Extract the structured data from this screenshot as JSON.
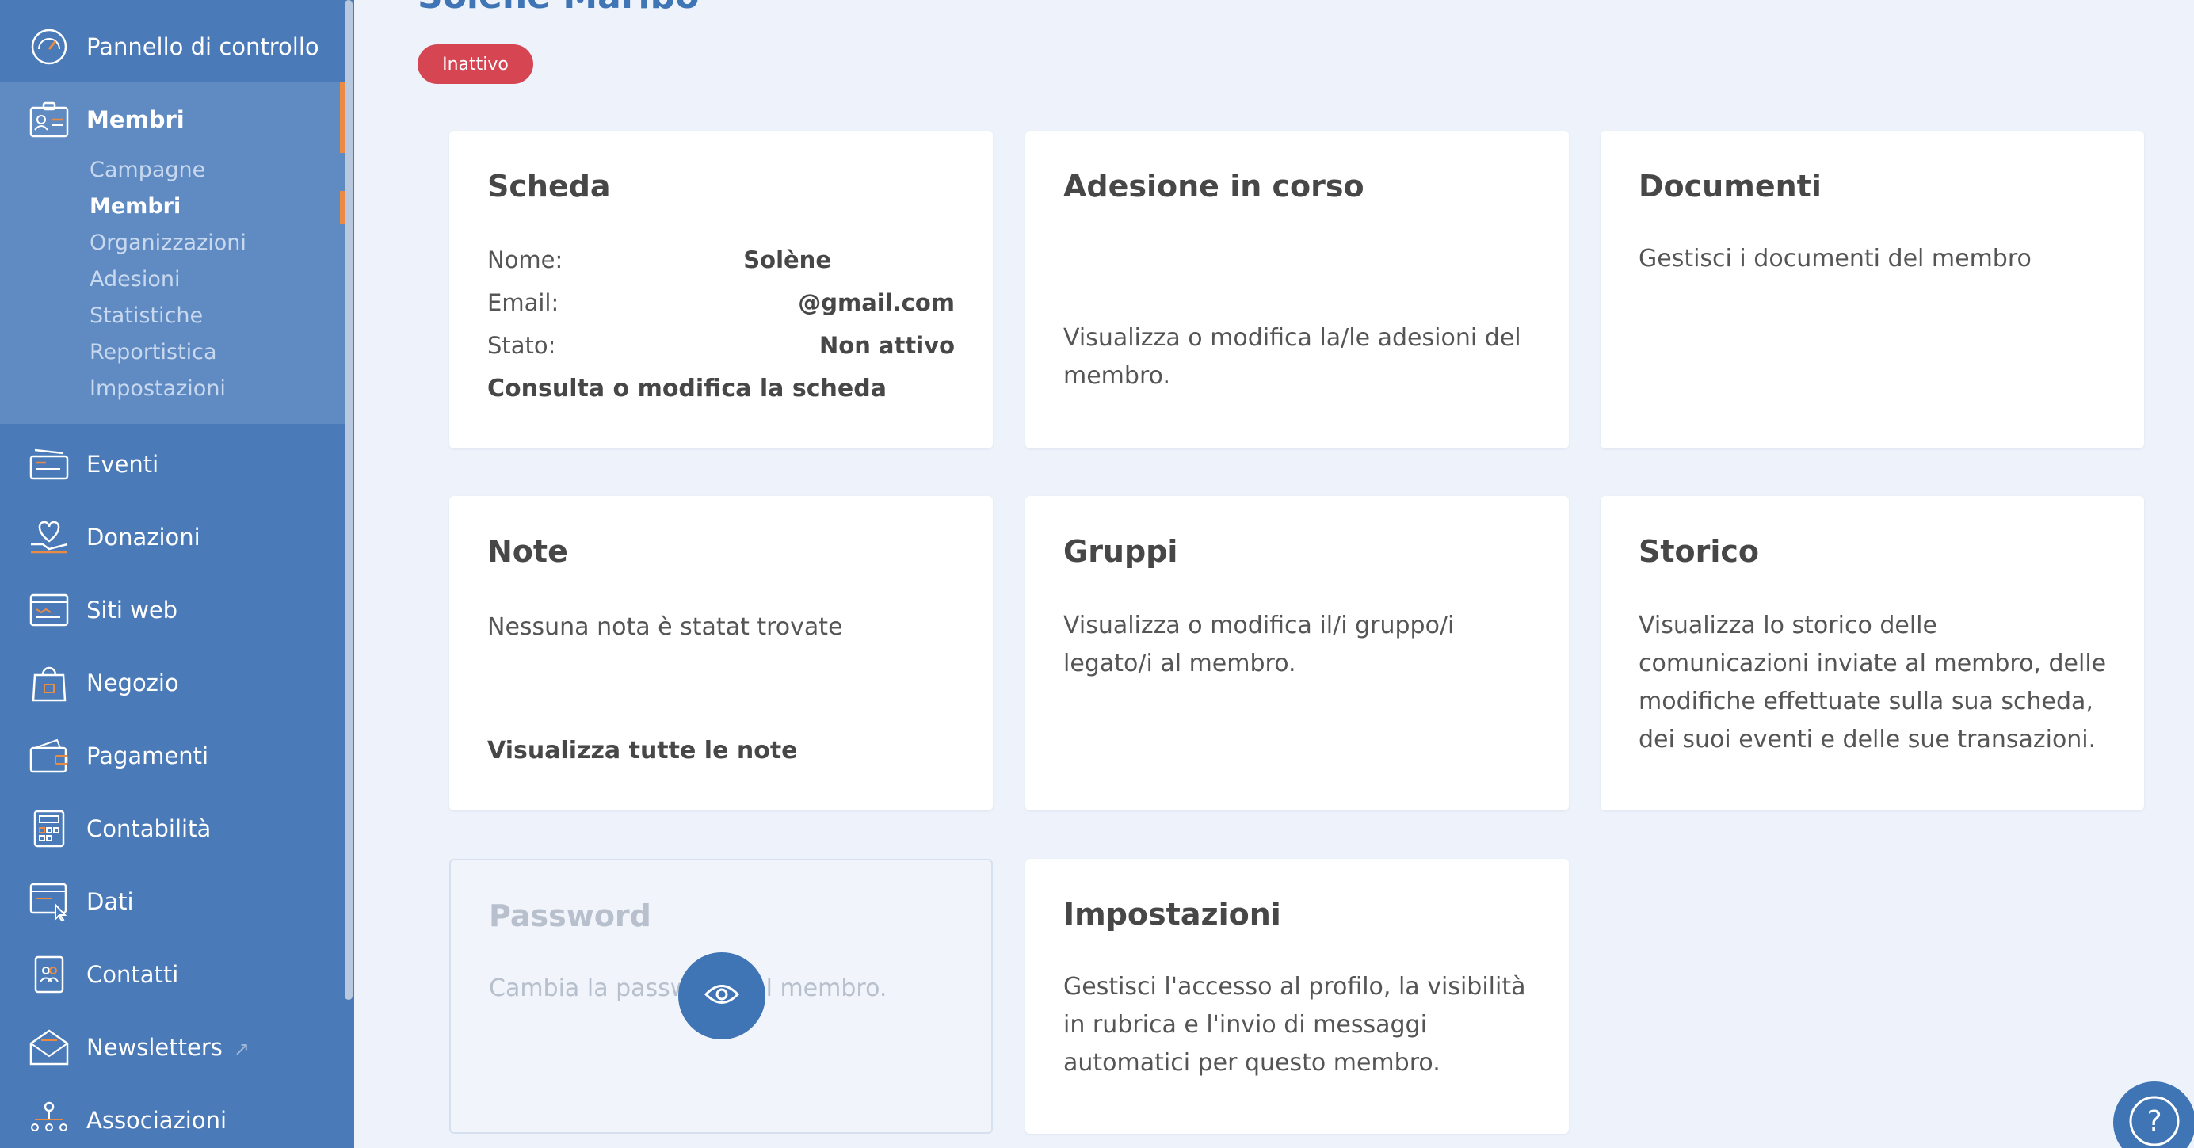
{
  "sidebar": {
    "dashboard": "Pannello di controllo",
    "members": "Membri",
    "submenu": [
      "Campagne",
      "Membri",
      "Organizzazioni",
      "Adesioni",
      "Statistiche",
      "Reportistica",
      "Impostazioni"
    ],
    "items": [
      "Eventi",
      "Donazioni",
      "Siti web",
      "Negozio",
      "Pagamenti",
      "Contabilità",
      "Dati",
      "Contatti",
      "Newsletters",
      "Associazioni"
    ]
  },
  "header": {
    "title": "Solène Maribo",
    "status_badge": "Inattivo"
  },
  "cards": {
    "scheda": {
      "title": "Scheda",
      "name_label": "Nome:",
      "name_value": "Solène",
      "email_label": "Email:",
      "email_value": "@gmail.com",
      "status_label": "Stato:",
      "status_value": "Non attivo",
      "link": "Consulta o modifica la scheda"
    },
    "adesione": {
      "title": "Adesione in corso",
      "text": "Visualizza o modifica la/le adesioni del membro."
    },
    "documenti": {
      "title": "Documenti",
      "text": "Gestisci i documenti del membro"
    },
    "note": {
      "title": "Note",
      "text": "Nessuna nota è statat trovate",
      "link": "Visualizza tutte le note"
    },
    "gruppi": {
      "title": "Gruppi",
      "text": "Visualizza o modifica il/i gruppo/i legato/i al membro."
    },
    "storico": {
      "title": "Storico",
      "text": "Visualizza lo storico delle comunicazioni inviate al membro, delle modifiche effettuate sulla sua scheda, dei suoi eventi e delle sue transazioni."
    },
    "password": {
      "title": "Password",
      "text": "Cambia la password del membro."
    },
    "impostazioni": {
      "title": "Impostazioni",
      "text": "Gestisci l'accesso al profilo, la visibilità in rubrica e l'invio di messaggi automatici per questo membro."
    }
  },
  "colors": {
    "sidebar": "#4a7ab8",
    "accent": "#e98b45",
    "primary": "#3f74b5",
    "badge": "#d64552"
  },
  "icons": [
    "dashboard-icon",
    "members-icon",
    "events-icon",
    "donations-icon",
    "website-icon",
    "shop-icon",
    "payments-icon",
    "accounting-icon",
    "data-icon",
    "contacts-icon",
    "newsletter-icon",
    "external-link-icon",
    "associations-icon",
    "eye-icon",
    "help-icon"
  ]
}
